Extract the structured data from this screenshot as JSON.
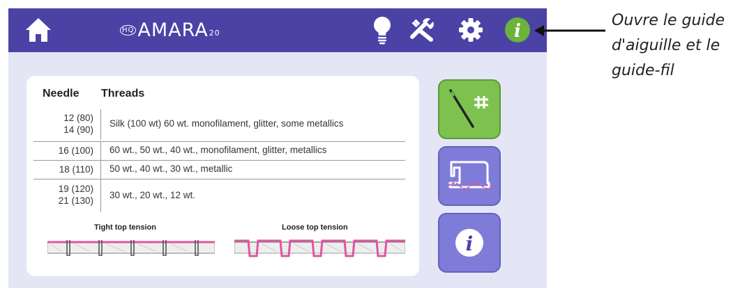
{
  "topbar": {
    "brand_prefix": "HQ",
    "brand_name": "AMARA",
    "brand_suffix": "20",
    "icons": [
      "home-icon",
      "lightbulb-icon",
      "tools-icon",
      "gear-icon",
      "info-icon"
    ]
  },
  "guide": {
    "headers": {
      "needle": "Needle",
      "threads": "Threads"
    },
    "rows": [
      {
        "needle": [
          "12 (80)",
          "14 (90)"
        ],
        "threads": "Silk (100 wt) 60 wt. monofilament, glitter, some metallics"
      },
      {
        "needle": [
          "16 (100)"
        ],
        "threads": "60 wt., 50 wt., 40 wt., monofilament, glitter, metallics"
      },
      {
        "needle": [
          "18 (110)"
        ],
        "threads": "50 wt., 40 wt., 30 wt., metallic"
      },
      {
        "needle": [
          "19 (120)",
          "21 (130)"
        ],
        "threads": "30 wt., 20 wt., 12 wt."
      }
    ],
    "tension": {
      "tight": "Tight top tension",
      "loose": "Loose top tension"
    }
  },
  "side_buttons": [
    {
      "name": "needle-guide",
      "icon": "needle-icon",
      "active": true
    },
    {
      "name": "thread-guide",
      "icon": "sewing-machine-icon",
      "active": false
    },
    {
      "name": "info",
      "icon": "info-icon",
      "active": false
    }
  ],
  "annotation": {
    "lines": [
      "Ouvre le guide",
      "d'aiguille et le",
      "guide-fil"
    ]
  },
  "colors": {
    "topbar": "#4b42a6",
    "screen_bg": "#e4e6f5",
    "active_button": "#7dc24f",
    "inactive_button": "#7f7cd9",
    "info_green": "#6bb33b",
    "thread_pink": "#e0559d"
  }
}
